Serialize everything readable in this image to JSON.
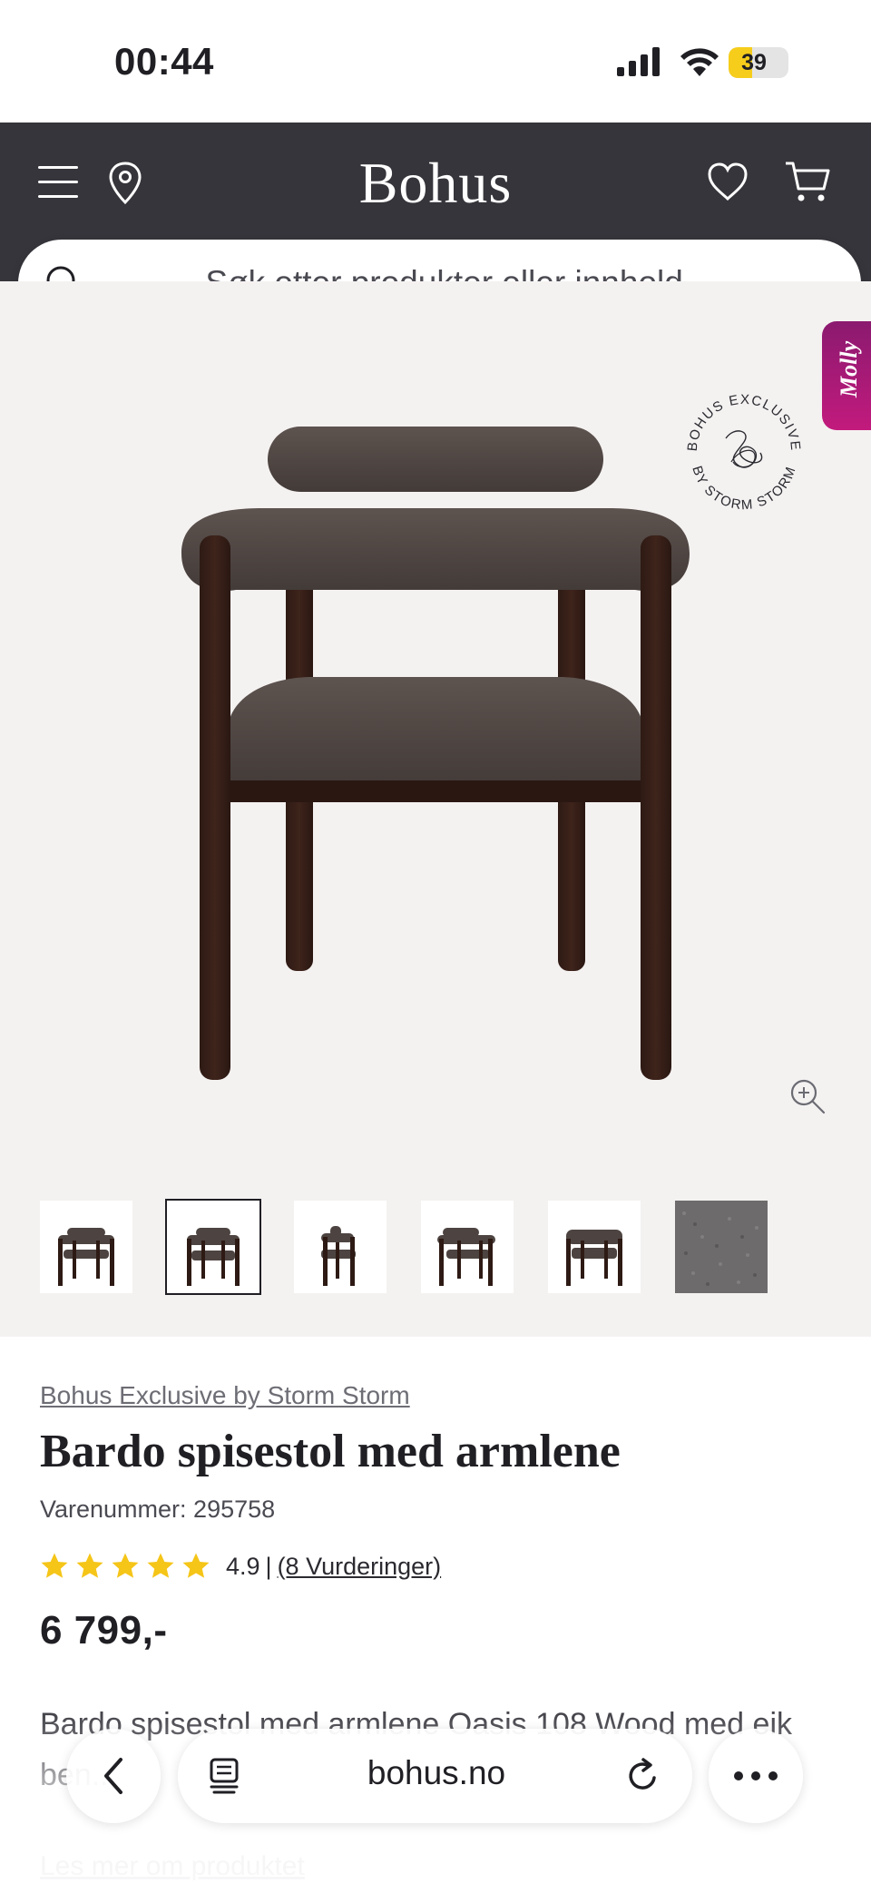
{
  "status_bar": {
    "time": "00:44",
    "battery_level": "39",
    "battery_fraction": 0.39
  },
  "header": {
    "logo": "Bohus",
    "icons": [
      "menu-icon",
      "location-pin-icon",
      "heart-icon",
      "cart-icon"
    ],
    "background_color": "#35353b"
  },
  "search": {
    "placeholder": "Søk etter produkter eller innhold...",
    "value": ""
  },
  "side_tab": {
    "label": "Molly"
  },
  "gallery": {
    "badge_text_top": "BOHUS EXCLUSIVE",
    "badge_text_bottom": "BY STORM STORM",
    "thumbnails": [
      {
        "name": "thumb-front-left",
        "selected": false
      },
      {
        "name": "thumb-front",
        "selected": true
      },
      {
        "name": "thumb-side",
        "selected": false
      },
      {
        "name": "thumb-angle",
        "selected": false
      },
      {
        "name": "thumb-back",
        "selected": false
      },
      {
        "name": "thumb-fabric",
        "selected": false
      }
    ]
  },
  "product": {
    "brand": "Bohus Exclusive by Storm Storm",
    "title": "Bardo spisestol med armlene",
    "sku": "Varenummer: 295758",
    "rating": {
      "stars": 5,
      "value": "4.9",
      "separator": "|",
      "count_label": "(8 Vurderinger)",
      "star_color": "#f5c518"
    },
    "price": "6 799,-",
    "description": "Bardo spisestol med armlene Oasis 108 Wood med eik ben...",
    "read_more": "Les mer om produktet"
  },
  "browser_bar": {
    "url": "bohus.no",
    "icons": [
      "back-icon",
      "tabs-icon",
      "reload-icon",
      "more-icon"
    ]
  }
}
